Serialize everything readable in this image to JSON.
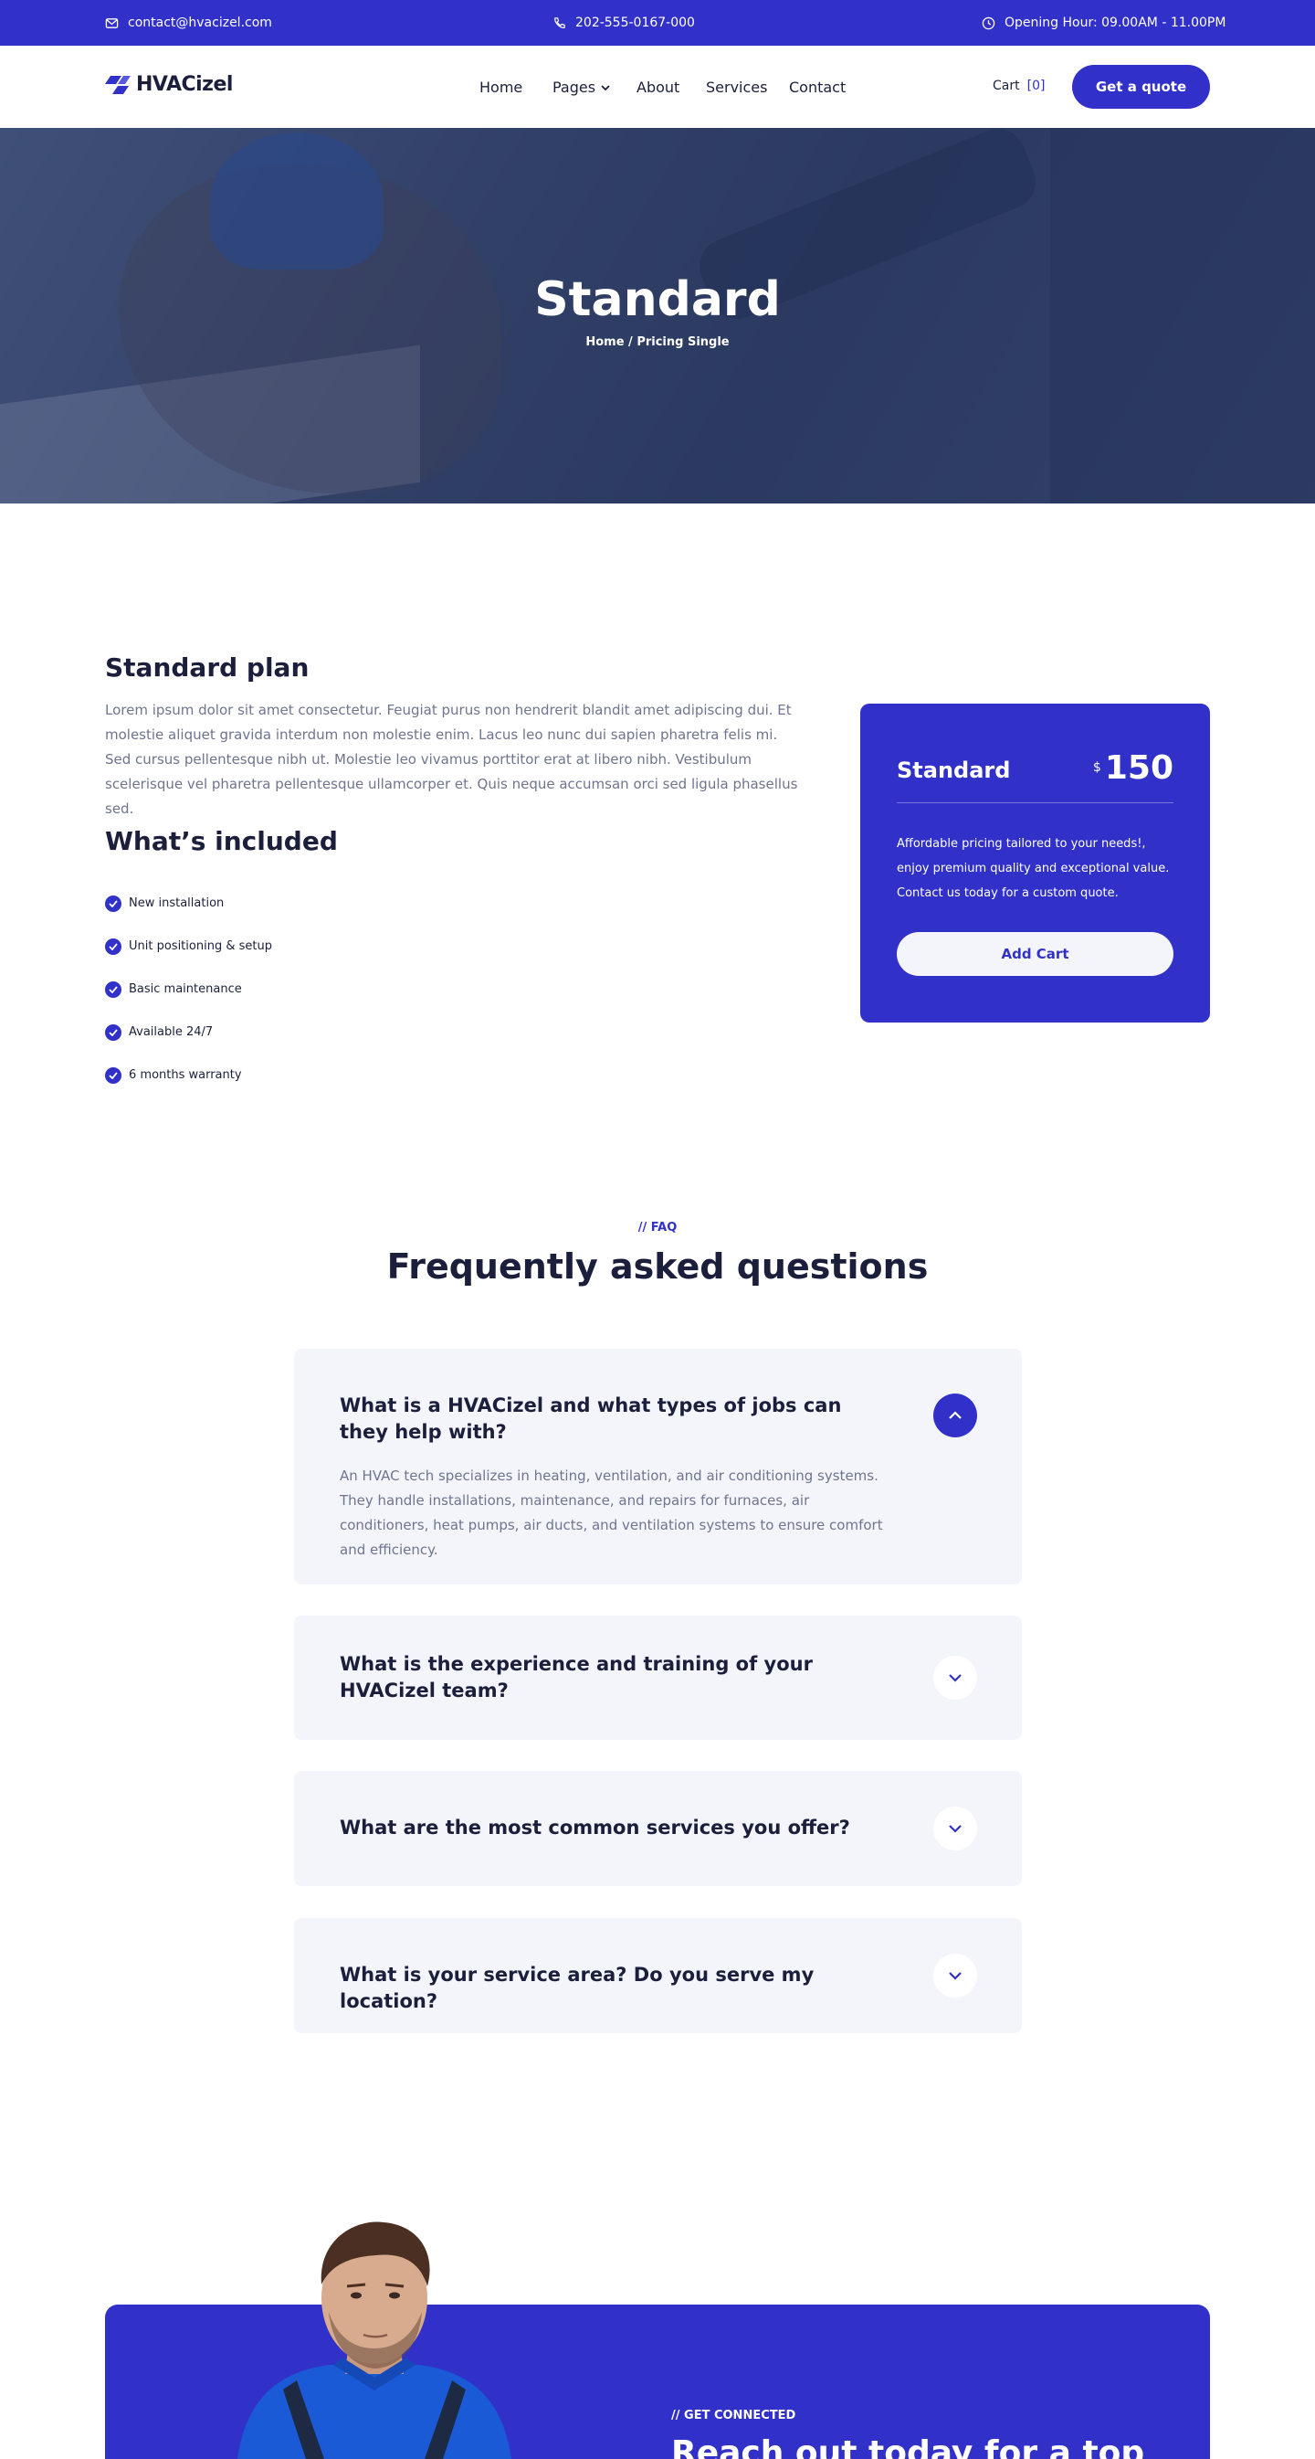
{
  "topbar": {
    "email": "contact@hvacizel.com",
    "phone": "202-555-0167-000",
    "hours": "Opening Hour: 09.00AM - 11.00PM",
    "email_icon": "mail-icon",
    "phone_icon": "phone-icon",
    "hours_icon": "clock-icon"
  },
  "header": {
    "logo": "HVACizel",
    "nav": [
      "Home",
      "Pages",
      "About",
      "Services",
      "Contact"
    ],
    "cart_label": "Cart",
    "cart_count": "[0]",
    "quote_button": "Get a quote"
  },
  "hero": {
    "title": "Standard",
    "breadcrumb": "Home / Pricing Single"
  },
  "plan": {
    "title": "Standard plan",
    "description": "Lorem ipsum dolor sit amet consectetur. Feugiat purus non hendrerit blandit amet adipiscing dui. Et molestie aliquet gravida interdum non molestie enim. Lacus leo nunc dui sapien pharetra felis mi. Sed cursus pellentesque nibh ut. Molestie leo vivamus porttitor erat at libero nibh. Vestibulum scelerisque vel pharetra pellentesque ullamcorper et. Quis neque accumsan orci sed ligula phasellus sed.",
    "included_title": "What’s included",
    "included": [
      "New installation",
      "Unit positioning & setup",
      "Basic maintenance",
      "Available 24/7",
      "6 months warranty"
    ]
  },
  "price_card": {
    "name": "Standard",
    "currency": "$",
    "amount": "150",
    "description": "Affordable pricing tailored to your needs!, enjoy premium quality and exceptional value. Contact us today for a custom quote.",
    "button": "Add Cart"
  },
  "faq": {
    "tag": "// FAQ",
    "heading": "Frequently asked questions",
    "items": [
      {
        "question": "What is a HVACizel and what types of jobs can they help with?",
        "answer": "An HVAC tech specializes in heating, ventilation, and air conditioning systems. They handle installations, maintenance, and repairs for furnaces, air conditioners, heat pumps, air ducts, and ventilation systems to ensure comfort and efficiency."
      },
      {
        "question": "What is the experience and training of your HVACizel team?"
      },
      {
        "question": "What are the most common services you offer?"
      },
      {
        "question": "What is your service area? Do you serve my location?"
      }
    ]
  },
  "cta": {
    "tag": "// GET CONNECTED",
    "heading": "Reach out today for a top"
  }
}
